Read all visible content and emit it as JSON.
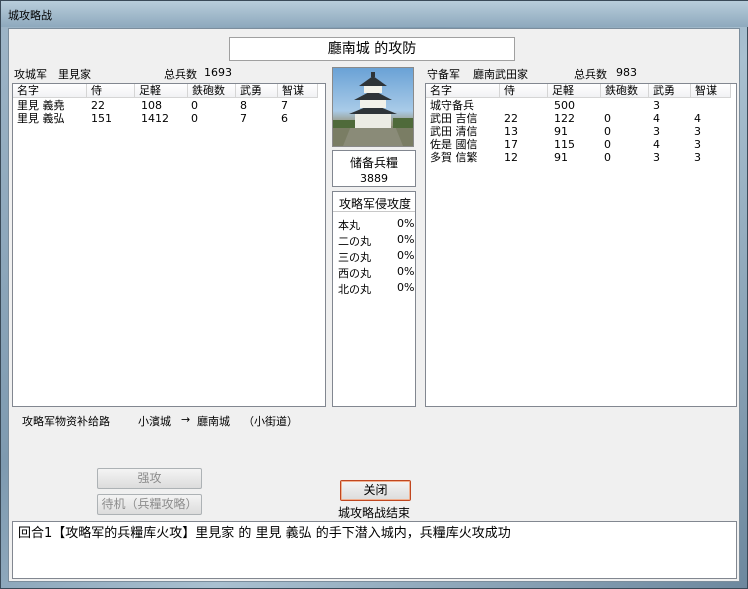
{
  "window": {
    "title": "城攻略战"
  },
  "caption": "廳南城 的攻防",
  "attacker": {
    "label": "攻城军",
    "clan": "里見家",
    "total_label": "总兵数",
    "total": "1693",
    "columns": [
      "名字",
      "侍",
      "足軽",
      "鉄砲数",
      "武勇",
      "智谋"
    ],
    "rows": [
      [
        "里見 義堯",
        "22",
        "108",
        "0",
        "8",
        "7"
      ],
      [
        "里見 義弘",
        "151",
        "1412",
        "0",
        "7",
        "6"
      ]
    ]
  },
  "defender": {
    "label": "守备军",
    "clan": "廳南武田家",
    "total_label": "总兵数",
    "total": "983",
    "columns": [
      "名字",
      "侍",
      "足軽",
      "鉄砲数",
      "武勇",
      "智谋"
    ],
    "rows": [
      [
        "城守备兵",
        "",
        "500",
        "",
        "3",
        ""
      ],
      [
        "武田 吉信",
        "22",
        "122",
        "0",
        "4",
        "4"
      ],
      [
        "武田 清信",
        "13",
        "91",
        "0",
        "3",
        "3"
      ],
      [
        "佐是 國信",
        "17",
        "115",
        "0",
        "4",
        "3"
      ],
      [
        "多賀 信繁",
        "12",
        "91",
        "0",
        "3",
        "3"
      ]
    ]
  },
  "supply": {
    "label": "储备兵糧",
    "value": "3889"
  },
  "invasion": {
    "label": "攻略军侵攻度",
    "items": [
      {
        "name": "本丸",
        "value": "0%"
      },
      {
        "name": "二の丸",
        "value": "0%"
      },
      {
        "name": "三の丸",
        "value": "0%"
      },
      {
        "name": "西の丸",
        "value": "0%"
      },
      {
        "name": "北の丸",
        "value": "0%"
      }
    ]
  },
  "route": {
    "label": "攻略军物资补给路",
    "from": "小濱城",
    "arrow": "→",
    "to": "廳南城",
    "via": "（小街道）"
  },
  "buttons": {
    "assault": "强攻",
    "wait": "待机（兵糧攻略）",
    "close": "关闭"
  },
  "status": "城攻略战结束",
  "log": "回合1【攻略军的兵糧库火攻】里見家 的 里見 義弘 的手下潜入城内，兵糧库火攻成功"
}
